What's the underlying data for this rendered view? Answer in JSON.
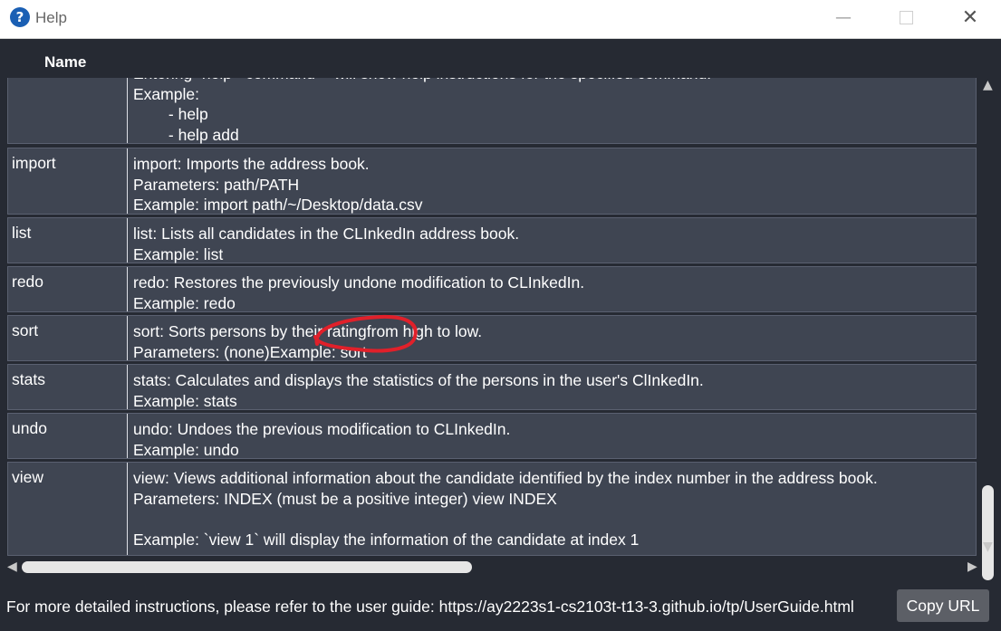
{
  "window": {
    "title": "Help",
    "icon": "question-icon",
    "min_glyph": "—",
    "close_glyph": "✕"
  },
  "table": {
    "header": "Name",
    "rows": [
      {
        "command": "",
        "description": "Entering `help <command>` will show help instructions for the specified command.\nExample:\n        - help\n        - help add"
      },
      {
        "command": "import",
        "description": "import: Imports the address book.\nParameters: path/PATH\nExample: import path/~/Desktop/data.csv"
      },
      {
        "command": "list",
        "description": "list: Lists all candidates in the CLInkedIn address book.\nExample: list"
      },
      {
        "command": "redo",
        "description": "redo: Restores the previously undone modification to CLInkedIn.\nExample: redo"
      },
      {
        "command": "sort",
        "description": "sort: Sorts persons by their ratingfrom high to low.\nParameters: (none)Example: sort"
      },
      {
        "command": "stats",
        "description": "stats: Calculates and displays the statistics of the persons in the user's ClInkedIn.\nExample: stats"
      },
      {
        "command": "undo",
        "description": "undo: Undoes the previous modification to CLInkedIn.\nExample: undo"
      },
      {
        "command": "view",
        "description": "view: Views additional information about the candidate identified by the index number in the address book.\nParameters: INDEX (must be a positive integer) view INDEX\n\nExample: `view 1` will display the information of the candidate at index 1"
      }
    ]
  },
  "footer": {
    "text": "For more detailed instructions, please refer to the user guide: https://ay2223s1-cs2103t-t13-3.github.io/tp/UserGuide.html",
    "copy_button": "Copy URL"
  },
  "colors": {
    "background": "#262a33",
    "row": "#3f4552",
    "annotation": "#e0202a"
  }
}
